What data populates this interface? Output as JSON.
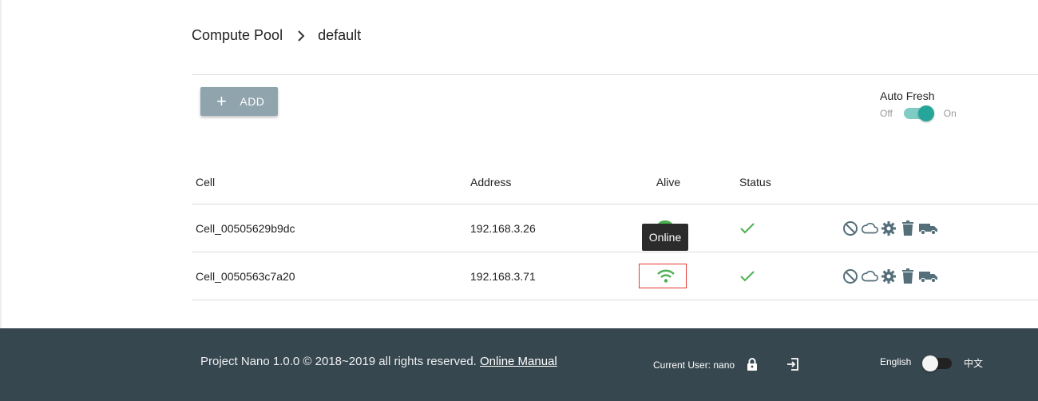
{
  "breadcrumb": {
    "root": "Compute Pool",
    "current": "default"
  },
  "toolbar": {
    "add_label": "ADD"
  },
  "auto_fresh": {
    "label": "Auto Fresh",
    "off": "Off",
    "on": "On",
    "enabled": true
  },
  "table": {
    "headers": {
      "cell": "Cell",
      "address": "Address",
      "alive": "Alive",
      "status": "Status"
    },
    "rows": [
      {
        "cell": "Cell_00505629b9dc",
        "address": "192.168.3.26",
        "alive": "online",
        "status": "ok"
      },
      {
        "cell": "Cell_0050563c7a20",
        "address": "192.168.3.71",
        "alive": "online",
        "status": "ok"
      }
    ]
  },
  "tooltip": {
    "text": "Online"
  },
  "footer": {
    "copyright": "Project Nano 1.0.0 © 2018~2019 all rights reserved.",
    "manual_link": "Online Manual",
    "current_user": "Current User: nano",
    "lang_en": "English",
    "lang_cn": "中文"
  },
  "colors": {
    "accent": "#26a69a",
    "success": "#4caf50",
    "footer_bg": "#37474f",
    "add_button": "#90a4ae",
    "icon_gray": "#546e7a",
    "highlight": "#e53935"
  }
}
